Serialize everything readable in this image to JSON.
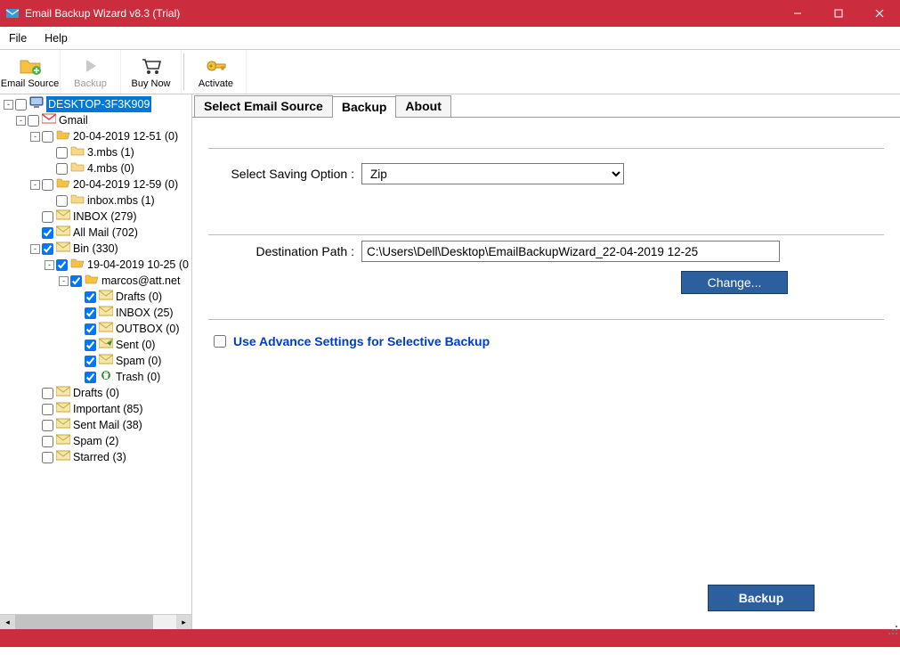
{
  "window": {
    "title": "Email Backup Wizard v8.3 (Trial)"
  },
  "menu": {
    "file": "File",
    "help": "Help"
  },
  "toolbar": {
    "email_source": "Email Source",
    "backup": "Backup",
    "buy_now": "Buy Now",
    "activate": "Activate"
  },
  "tabs": {
    "select_source": "Select Email Source",
    "backup": "Backup",
    "about": "About"
  },
  "backup_tab": {
    "saving_option_label": "Select Saving Option :",
    "saving_option_value": "Zip",
    "destination_label": "Destination Path :",
    "destination_value": "C:\\Users\\Dell\\Desktop\\EmailBackupWizard_22-04-2019 12-25",
    "change_btn": "Change...",
    "advance_label": "Use Advance Settings for Selective Backup",
    "backup_btn": "Backup"
  },
  "tree": [
    {
      "indent": 0,
      "exp": "-",
      "checked": false,
      "icon": "computer",
      "label": "DESKTOP-3F3K909",
      "selected": true
    },
    {
      "indent": 1,
      "exp": "-",
      "checked": false,
      "icon": "gmail",
      "label": "Gmail"
    },
    {
      "indent": 2,
      "exp": "-",
      "checked": false,
      "icon": "folder-open",
      "label": "20-04-2019 12-51 (0)"
    },
    {
      "indent": 3,
      "exp": "",
      "checked": false,
      "icon": "folder-closed",
      "label": "3.mbs (1)"
    },
    {
      "indent": 3,
      "exp": "",
      "checked": false,
      "icon": "folder-closed",
      "label": "4.mbs (0)"
    },
    {
      "indent": 2,
      "exp": "-",
      "checked": false,
      "icon": "folder-open",
      "label": "20-04-2019 12-59 (0)"
    },
    {
      "indent": 3,
      "exp": "",
      "checked": false,
      "icon": "folder-closed",
      "label": "inbox.mbs (1)"
    },
    {
      "indent": 2,
      "exp": "",
      "checked": false,
      "icon": "mail",
      "label": "INBOX (279)"
    },
    {
      "indent": 2,
      "exp": "",
      "checked": true,
      "icon": "mail",
      "label": "All Mail (702)"
    },
    {
      "indent": 2,
      "exp": "-",
      "checked": true,
      "icon": "mail",
      "label": "Bin (330)"
    },
    {
      "indent": 3,
      "exp": "-",
      "checked": true,
      "icon": "folder-open",
      "label": "19-04-2019 10-25 (0"
    },
    {
      "indent": 4,
      "exp": "-",
      "checked": true,
      "icon": "folder-open",
      "label": "marcos@att.net"
    },
    {
      "indent": 5,
      "exp": "",
      "checked": true,
      "icon": "mail",
      "label": "Drafts (0)"
    },
    {
      "indent": 5,
      "exp": "",
      "checked": true,
      "icon": "mail",
      "label": "INBOX (25)"
    },
    {
      "indent": 5,
      "exp": "",
      "checked": true,
      "icon": "mail",
      "label": "OUTBOX (0)"
    },
    {
      "indent": 5,
      "exp": "",
      "checked": true,
      "icon": "mail-sent",
      "label": "Sent (0)"
    },
    {
      "indent": 5,
      "exp": "",
      "checked": true,
      "icon": "mail",
      "label": "Spam (0)"
    },
    {
      "indent": 5,
      "exp": "",
      "checked": true,
      "icon": "trash",
      "label": "Trash (0)"
    },
    {
      "indent": 2,
      "exp": "",
      "checked": false,
      "icon": "mail",
      "label": "Drafts (0)"
    },
    {
      "indent": 2,
      "exp": "",
      "checked": false,
      "icon": "mail",
      "label": "Important (85)"
    },
    {
      "indent": 2,
      "exp": "",
      "checked": false,
      "icon": "mail",
      "label": "Sent Mail (38)"
    },
    {
      "indent": 2,
      "exp": "",
      "checked": false,
      "icon": "mail",
      "label": "Spam (2)"
    },
    {
      "indent": 2,
      "exp": "",
      "checked": false,
      "icon": "mail",
      "label": "Starred (3)"
    }
  ]
}
